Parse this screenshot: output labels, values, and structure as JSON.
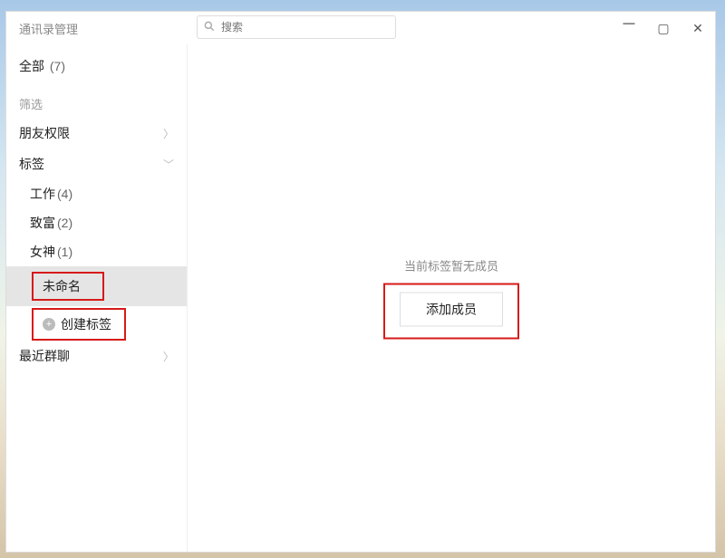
{
  "window": {
    "title": "通讯录管理"
  },
  "search": {
    "placeholder": "搜索"
  },
  "sidebar": {
    "all_label": "全部",
    "all_count": "(7)",
    "filter_label": "筛选",
    "friend_perm_label": "朋友权限",
    "tags_label": "标签",
    "tag_items": [
      {
        "label": "工作",
        "count": "(4)"
      },
      {
        "label": "致富",
        "count": "(2)"
      },
      {
        "label": "女神",
        "count": "(1)"
      },
      {
        "label": "未命名",
        "count": ""
      }
    ],
    "create_tag_label": "创建标签",
    "recent_group_label": "最近群聊"
  },
  "main": {
    "empty_text": "当前标签暂无成员",
    "add_member_label": "添加成员"
  }
}
